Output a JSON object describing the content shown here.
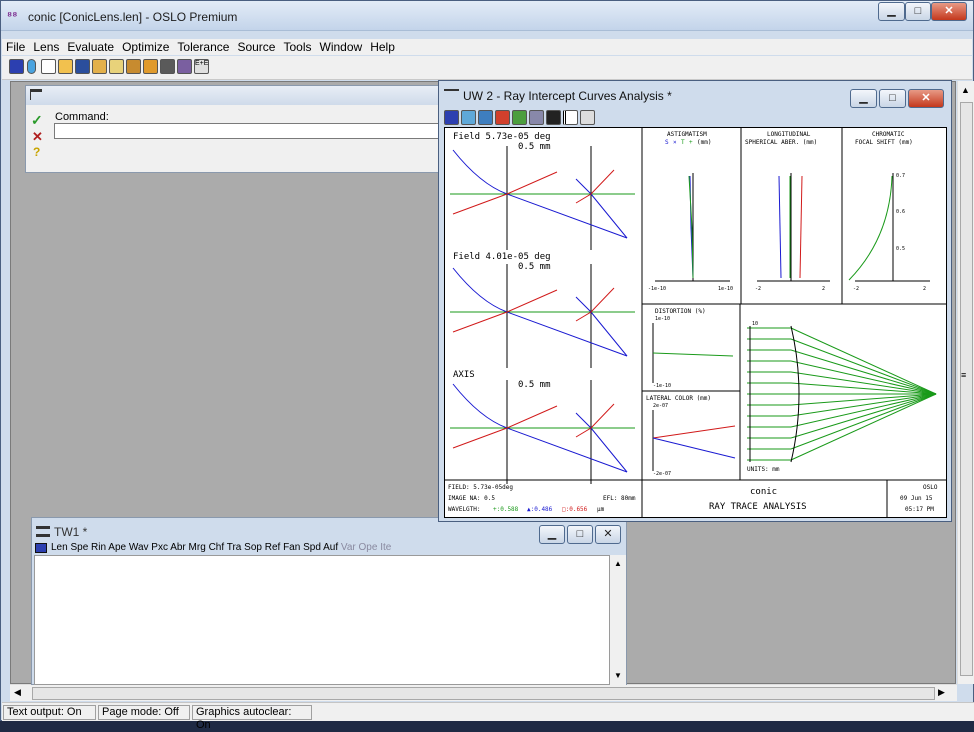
{
  "app": {
    "title": "conic [ConicLens.len] - OSLO Premium",
    "icon": "oslo-logo-icon"
  },
  "menu": [
    "File",
    "Lens",
    "Evaluate",
    "Optimize",
    "Tolerance",
    "Source",
    "Tools",
    "Window",
    "Help"
  ],
  "toolbar_icons": [
    "lens-data-icon",
    "lens-icon",
    "new-icon",
    "open-icon",
    "save-icon",
    "edit-icon",
    "notes-icon",
    "catalog-icon",
    "gears-icon",
    "book-icon",
    "people-icon",
    "e-hi-icon"
  ],
  "command": {
    "label": "Command:",
    "value": "",
    "accept_icon": "checkmark-icon",
    "cancel_icon": "x-icon",
    "help_icon": "question-icon",
    "header_icon": "table-icon"
  },
  "tw": {
    "title": "TW1 *",
    "buttons": [
      "Len",
      "Spe",
      "Rin",
      "Ape",
      "Wav",
      "Pxc",
      "Abr",
      "Mrg",
      "Chf",
      "Tra",
      "Sop",
      "Ref",
      "Fan",
      "Spd",
      "Auf",
      "Var",
      "Ope",
      "Ite"
    ]
  },
  "uw": {
    "title": "UW 2 - Ray Intercept Curves Analysis *",
    "fields": [
      {
        "label": "Field 5.73e-05 deg",
        "scale": "0.5 mm"
      },
      {
        "label": "Field 4.01e-05 deg",
        "scale": "0.5 mm"
      },
      {
        "label": "AXIS",
        "scale": "0.5 mm"
      }
    ],
    "astig": {
      "title": "ASTIGMATISM",
      "legend_s": "S",
      "legend_x": "×",
      "legend_t": "T",
      "legend_plus": "+",
      "unit": "(mm)",
      "xmin": "-1e-10",
      "xmax": "1e-10"
    },
    "lsa": {
      "title1": "LONGITUDINAL",
      "title2": "SPHERICAL ABER. (mm)",
      "xmin": "-2",
      "xmax": "2"
    },
    "cfs": {
      "title1": "CHROMATIC",
      "title2": "FOCAL SHIFT (mm)",
      "xmin": "-2",
      "xmax": "2",
      "t1": "0.7",
      "t2": "0.6",
      "t3": "0.5"
    },
    "distortion": {
      "title": "DISTORTION (%)",
      "top": "1e-10",
      "bottom": "-1e-10"
    },
    "latcol": {
      "title": "LATERAL COLOR (mm)",
      "top": "2e-07",
      "bottom": "-2e-07"
    },
    "layout": {
      "top_label": "10",
      "units": "UNITS: mm"
    },
    "footer": {
      "field": "FIELD: 5.73e-05deg",
      "na": "IMAGE NA: 0.5",
      "efl": "EFL: 80mm",
      "wavelength_label": "WAVELGTH:",
      "w1": "+:0.588",
      "w2": "▲:0.486",
      "w3": "□:0.656",
      "w_unit": "µm",
      "lens": "conic",
      "analysis": "RAY TRACE ANALYSIS",
      "program": "OSLO",
      "date": "09 Jun 15",
      "time": "05:17 PM"
    }
  },
  "status": {
    "text_output": "Text output: On",
    "page_mode": "Page mode: Off",
    "graphics": "Graphics autoclear: On"
  }
}
